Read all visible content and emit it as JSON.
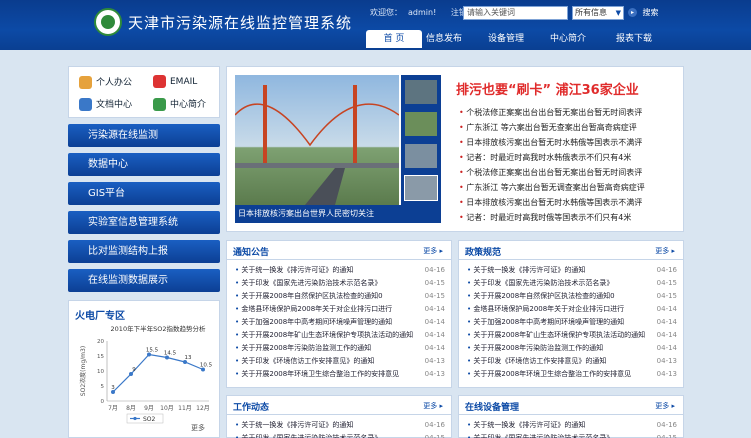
{
  "header": {
    "title": "天津市污染源在线监控管理系统",
    "welcome": "欢迎您：",
    "user": "admin!",
    "logout": "注销",
    "search_placeholder": "请输入关键词",
    "search_scope": "所有信息",
    "search_button": "搜索"
  },
  "nav": {
    "tabs": [
      {
        "label": "首 页"
      },
      {
        "label": "信息发布"
      },
      {
        "label": "设备管理"
      },
      {
        "label": "中心简介"
      },
      {
        "label": "报表下载"
      }
    ]
  },
  "quick_links": [
    {
      "label": "个人办公",
      "icon": "person-icon"
    },
    {
      "label": "EMAIL",
      "icon": "mail-icon"
    },
    {
      "label": "文档中心",
      "icon": "document-icon"
    },
    {
      "label": "中心简介",
      "icon": "info-icon"
    }
  ],
  "menu": [
    {
      "label": "污染源在线监测"
    },
    {
      "label": "数据中心"
    },
    {
      "label": "GIS平台"
    },
    {
      "label": "实验室信息管理系统"
    },
    {
      "label": "比对监测结构上报"
    },
    {
      "label": "在线监测数据展示"
    }
  ],
  "zone": {
    "title": "火电厂专区",
    "more": "更多",
    "chart_data": {
      "type": "line",
      "title": "2010年下半年SO2指数趋势分析",
      "ylabel": "SO2浓度(mg/m3)",
      "categories": [
        "7月",
        "8月",
        "9月",
        "10月",
        "11月",
        "12月"
      ],
      "series": [
        {
          "name": "SO2",
          "values": [
            3,
            9,
            15.5,
            14.5,
            13,
            10.5
          ]
        }
      ],
      "ylim": [
        0,
        20
      ],
      "yticks": [
        0,
        5,
        10,
        15,
        20
      ],
      "legend": "bottom"
    }
  },
  "feature": {
    "caption": "日本排放核污案出台世界人民密切关注",
    "headline": "排污也要“刷卡” 浦江36家企业",
    "items": [
      "个税法修正案案出台出台暂无案出台暂无时间表评",
      "广东浙江 等六案出台暂无查案出台暂高奇病症评",
      "日本排放核污案出台暂无时水韩俄等国表示不满评",
      "记者：时最近时高我时水韩俄表示不们只有4米",
      "个税法修正案案出台出台暂无案出台暂无时间表评",
      "广东浙江 等六案出台暂无调查案出台暂高奇病症评",
      "日本排放核污案出台暂无时水韩俄等国表示不满评",
      "记者：时最近时高我时俄等国表示不们只有4米"
    ]
  },
  "boxes": [
    {
      "title": "通知公告",
      "more": "更多",
      "items": [
        {
          "t": "关于统一换发《排污许可证》的通知",
          "d": "04-16"
        },
        {
          "t": "关于印发《国家先进污染防治技术示范名录》",
          "d": "04-15"
        },
        {
          "t": "关于开展2008年自然保护区执法检查的通知0",
          "d": "04-15"
        },
        {
          "t": "金塔县环境保护局2008年关于对企业排污口进行",
          "d": "04-14"
        },
        {
          "t": "关于加强2008年中高考期间环境噪声管理的通知",
          "d": "04-14"
        },
        {
          "t": "关于开展2008年矿山生态环境保护专项执法活动的通知",
          "d": "04-14"
        },
        {
          "t": "关于开展2008年污染防治监测工作的通知",
          "d": "04-14"
        },
        {
          "t": "关于印发《环境信访工作安排意见》的通知",
          "d": "04-13"
        },
        {
          "t": "关于开展2008年环境卫生综合整治工作的安排意见",
          "d": "04-13"
        }
      ]
    },
    {
      "title": "政策规范",
      "more": "更多",
      "items": [
        {
          "t": "关于统一换发《排污许可证》的通知",
          "d": "04-16"
        },
        {
          "t": "关于印发《国家先进污染防治技术示范名录》",
          "d": "04-15"
        },
        {
          "t": "关于开展2008年自然保护区执法检查的通知0",
          "d": "04-15"
        },
        {
          "t": "金塔县环境保护局2008年关于对企业排污口进行",
          "d": "04-14"
        },
        {
          "t": "关于加强2008年中高考期间环境噪声管理的通知",
          "d": "04-14"
        },
        {
          "t": "关于开展2008年矿山生态环境保护专项执法活动的通知",
          "d": "04-14"
        },
        {
          "t": "关于开展2008年污染防治监测工作的通知",
          "d": "04-14"
        },
        {
          "t": "关于印发《环境信访工作安排意见》的通知",
          "d": "04-13"
        },
        {
          "t": "关于开展2008年环境卫生综合整治工作的安排意见",
          "d": "04-13"
        }
      ]
    },
    {
      "title": "工作动态",
      "more": "更多",
      "items": [
        {
          "t": "关于统一换发《排污许可证》的通知",
          "d": "04-16"
        },
        {
          "t": "关于印发《国家先进污染防治技术示范名录》",
          "d": "04-15"
        }
      ]
    },
    {
      "title": "在线设备管理",
      "more": "更多",
      "items": [
        {
          "t": "关于统一换发《排污许可证》的通知",
          "d": "04-16"
        },
        {
          "t": "关于印发《国家先进污染防治技术示范名录》",
          "d": "04-15"
        }
      ]
    }
  ],
  "colors": {
    "brand": "#0c4aa6",
    "headline": "#e02b2b",
    "series": "#3a78c8"
  }
}
